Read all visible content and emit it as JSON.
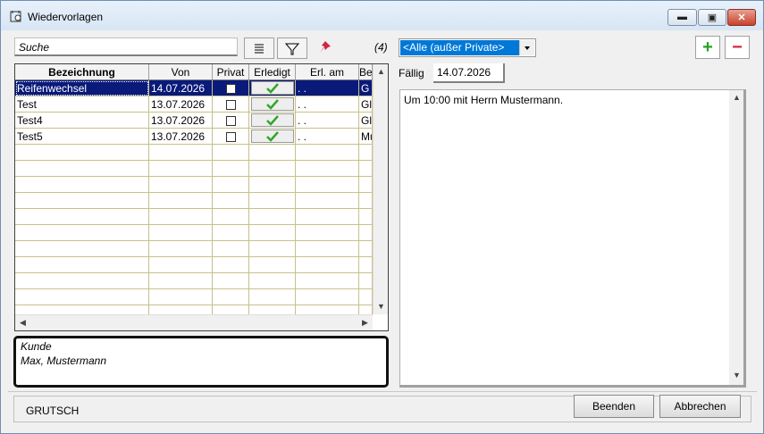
{
  "window": {
    "title": "Wiedervorlagen"
  },
  "toolbar": {
    "search_placeholder": "Suche",
    "count": "(4)",
    "filter_selected": "<Alle (außer Private>"
  },
  "grid": {
    "columns": [
      "Bezeichnung",
      "Von",
      "Privat",
      "Erledigt",
      "Erl. am",
      "Be"
    ],
    "rows": [
      {
        "bezeichnung": "Reifenwechsel",
        "von": "14.07.2026",
        "erl_am": ". .",
        "be": "G",
        "selected": true
      },
      {
        "bezeichnung": "Test",
        "von": "13.07.2026",
        "erl_am": ". .",
        "be": "Gl"
      },
      {
        "bezeichnung": "Test4",
        "von": "13.07.2026",
        "erl_am": ". .",
        "be": "Gl"
      },
      {
        "bezeichnung": "Test5",
        "von": "13.07.2026",
        "erl_am": ". .",
        "be": "Mu"
      }
    ]
  },
  "kunde": {
    "label": "Kunde",
    "name": "Max, Mustermann"
  },
  "detail": {
    "faellig_label": "Fällig",
    "faellig_value": "14.07.2026",
    "notes": "Um 10:00 mit Herrn Mustermann."
  },
  "footer": {
    "user": "GRUTSCH",
    "beenden_label": "Beenden",
    "abbrechen_label": "Abbrechen"
  },
  "colors": {
    "selection": "#0a1a7a",
    "accent_add": "#25a325",
    "accent_del": "#d4243c"
  }
}
